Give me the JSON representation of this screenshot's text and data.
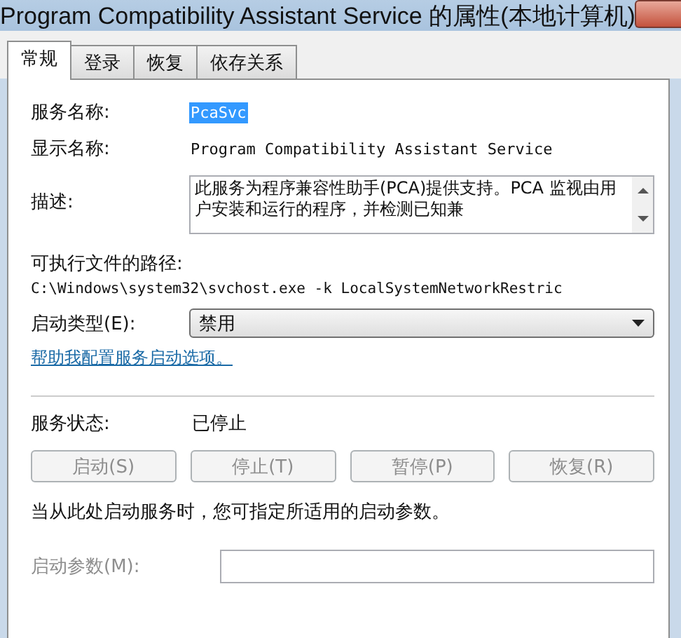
{
  "window": {
    "title": "Program Compatibility Assistant Service 的属性(本地计算机)"
  },
  "tabs": [
    {
      "label": "常规",
      "selected": true
    },
    {
      "label": "登录",
      "selected": false
    },
    {
      "label": "恢复",
      "selected": false
    },
    {
      "label": "依存关系",
      "selected": false
    }
  ],
  "service_name": {
    "label": "服务名称:",
    "value": "PcaSvc",
    "selected": true
  },
  "display_name": {
    "label": "显示名称:",
    "value": "Program Compatibility Assistant Service"
  },
  "description": {
    "label": "描述:",
    "value": "此服务为程序兼容性助手(PCA)提供支持。PCA 监视由用户安装和运行的程序，并检测已知兼"
  },
  "path": {
    "label": "可执行文件的路径:",
    "value": "C:\\Windows\\system32\\svchost.exe -k LocalSystemNetworkRestric"
  },
  "startup_type": {
    "label": "启动类型(E):",
    "value": "禁用"
  },
  "help_link": "帮助我配置服务启动选项。",
  "status": {
    "label": "服务状态:",
    "value": "已停止"
  },
  "buttons": [
    {
      "label": "启动(S)",
      "disabled": true
    },
    {
      "label": "停止(T)",
      "disabled": true
    },
    {
      "label": "暂停(P)",
      "disabled": true
    },
    {
      "label": "恢复(R)",
      "disabled": true
    }
  ],
  "params_hint": "当从此处启动服务时，您可指定所适用的启动参数。",
  "start_params": {
    "label": "启动参数(M):",
    "disabled": true
  }
}
